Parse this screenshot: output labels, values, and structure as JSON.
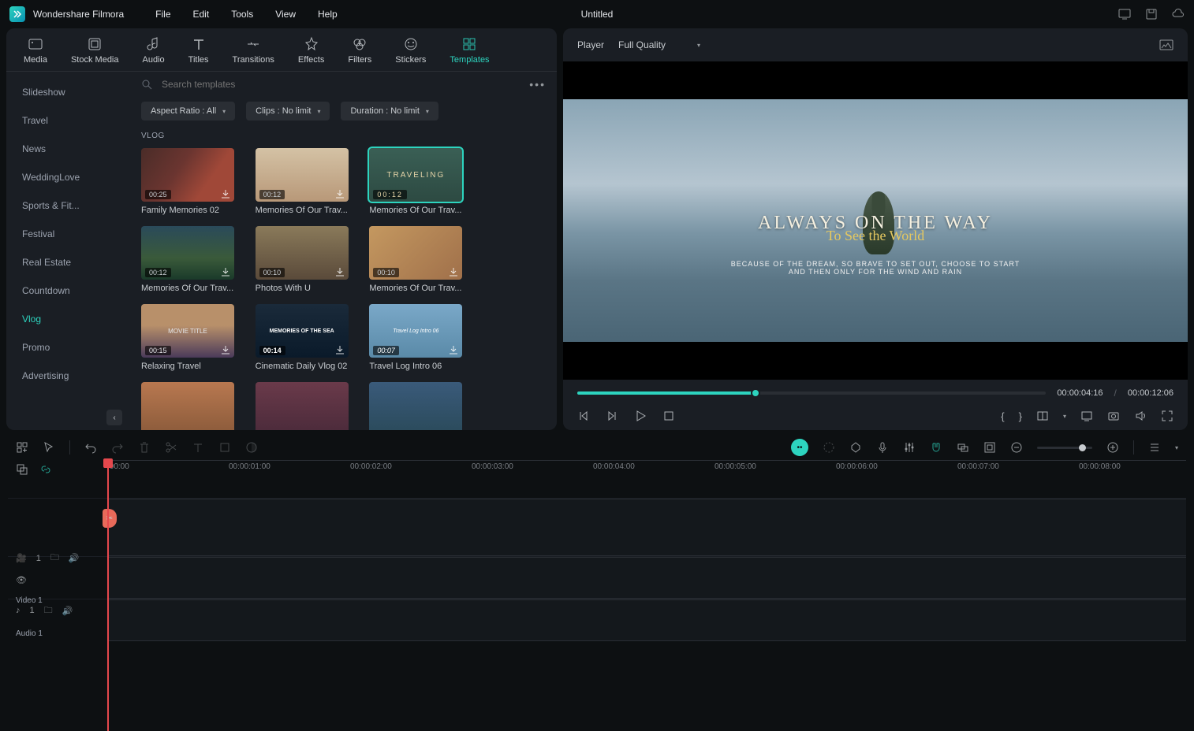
{
  "app": {
    "name": "Wondershare Filmora",
    "document": "Untitled"
  },
  "menu": [
    "File",
    "Edit",
    "Tools",
    "View",
    "Help"
  ],
  "tool_tabs": [
    {
      "label": "Media"
    },
    {
      "label": "Stock Media"
    },
    {
      "label": "Audio"
    },
    {
      "label": "Titles"
    },
    {
      "label": "Transitions"
    },
    {
      "label": "Effects"
    },
    {
      "label": "Filters"
    },
    {
      "label": "Stickers"
    },
    {
      "label": "Templates",
      "active": true
    }
  ],
  "sidebar": {
    "items": [
      "Slideshow",
      "Travel",
      "News",
      "WeddingLove",
      "Sports & Fit...",
      "Festival",
      "Real Estate",
      "Countdown",
      "Vlog",
      "Promo",
      "Advertising"
    ],
    "active": "Vlog"
  },
  "search": {
    "placeholder": "Search templates"
  },
  "filters": {
    "aspect": "Aspect Ratio : All",
    "clips": "Clips : No limit",
    "duration": "Duration : No limit"
  },
  "section": "VLOG",
  "templates": [
    {
      "name": "Family Memories 02",
      "dur": "00:25"
    },
    {
      "name": "Memories Of Our Trav...",
      "dur": "00:12"
    },
    {
      "name": "Memories Of Our Trav...",
      "dur": "00:12",
      "selected": true
    },
    {
      "name": "Memories Of Our Trav...",
      "dur": "00:12"
    },
    {
      "name": "Photos With U",
      "dur": "00:10"
    },
    {
      "name": "Memories Of Our Trav...",
      "dur": "00:10"
    },
    {
      "name": "Relaxing Travel",
      "dur": "00:15"
    },
    {
      "name": "Cinematic Daily Vlog 02",
      "dur": "00:14"
    },
    {
      "name": "Travel Log Intro 06",
      "dur": "00:07"
    }
  ],
  "player": {
    "label": "Player",
    "quality": "Full Quality",
    "current_time": "00:00:04:16",
    "total_time": "00:00:12:06"
  },
  "preview": {
    "title": "ALWAYS ON THE WAY",
    "script": "To See the World",
    "sub1": "BECAUSE OF THE DREAM, SO BRAVE TO SET OUT, CHOOSE TO START",
    "sub2": "AND THEN ONLY FOR THE WIND AND RAIN"
  },
  "ruler": [
    ":00:00",
    "00:00:01:00",
    "00:00:02:00",
    "00:00:03:00",
    "00:00:04:00",
    "00:00:05:00",
    "00:00:06:00",
    "00:00:07:00",
    "00:00:08:00"
  ],
  "tracks": {
    "video": {
      "name": "Video 1",
      "num": "1"
    },
    "audio": {
      "name": "Audio 1",
      "num": "1"
    }
  },
  "thumb_text": {
    "traveling": "TRAVELING",
    "movie": "MOVIE TITLE",
    "sea": "MEMORIES OF THE SEA",
    "log": "Travel Log Intro 06"
  }
}
